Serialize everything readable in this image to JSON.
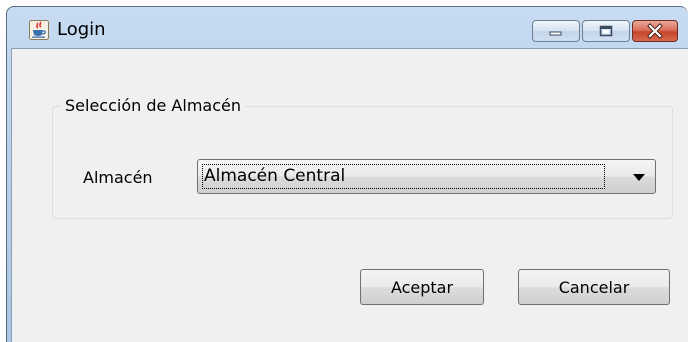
{
  "window": {
    "title": "Login",
    "icon": "java-cup-icon",
    "caption_buttons": [
      "minimize-icon",
      "maximize-icon",
      "close-icon"
    ]
  },
  "group": {
    "title": "Selección de Almacén"
  },
  "field": {
    "label": "Almacén",
    "selected_value": "Almacén Central"
  },
  "buttons": {
    "accept_label": "Aceptar",
    "cancel_label": "Cancelar"
  },
  "colors": {
    "titlebar": "#b9d1ec",
    "client": "#f0f0f0",
    "close_button": "#c6442a"
  }
}
